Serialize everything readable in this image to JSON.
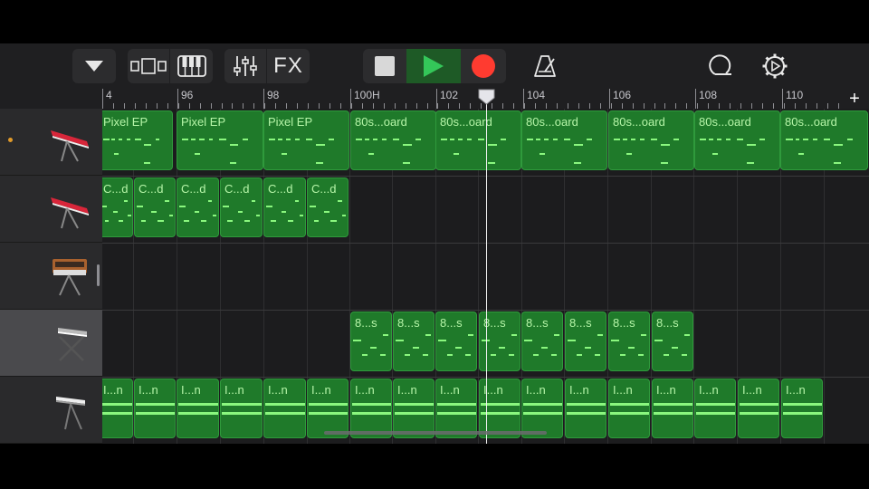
{
  "toolbar": {
    "buttons": [
      {
        "name": "tracks-menu",
        "icon": "chevron-down-icon"
      },
      {
        "name": "tracks-view",
        "icon": "tracks-view-icon"
      },
      {
        "name": "instrument-view",
        "icon": "piano-keys-icon"
      },
      {
        "name": "mixer",
        "icon": "mixer-sliders-icon"
      },
      {
        "name": "fx",
        "label": "FX"
      },
      {
        "name": "stop",
        "icon": "stop-icon"
      },
      {
        "name": "play",
        "icon": "play-icon"
      },
      {
        "name": "record",
        "icon": "record-icon"
      },
      {
        "name": "metronome",
        "icon": "metronome-icon"
      },
      {
        "name": "loop-browser",
        "icon": "loop-icon"
      },
      {
        "name": "settings",
        "icon": "gear-icon"
      }
    ],
    "fx_label": "FX",
    "colors": {
      "play": "#34c759",
      "record": "#ff3b30"
    }
  },
  "ruler": {
    "labels": [
      "4",
      "96",
      "98",
      "100H",
      "102",
      "104",
      "106",
      "108",
      "110"
    ],
    "add_label": "+"
  },
  "tracks": [
    {
      "instrument": "red-keyboard-icon",
      "selected": false,
      "record_enabled": true,
      "regions": [
        "Pixel EP",
        "Pixel EP",
        "Pixel EP",
        "80s...oard",
        "80s...oard",
        "80s...oard",
        "80s...oard",
        "80s...oard",
        "80s...oard"
      ]
    },
    {
      "instrument": "red-keyboard-icon",
      "selected": false,
      "record_enabled": false,
      "regions": [
        "C...d",
        "C...d",
        "C...d",
        "C...d",
        "C...d",
        "C...d"
      ]
    },
    {
      "instrument": "synth-icon",
      "selected": false,
      "record_enabled": false,
      "regions": []
    },
    {
      "instrument": "keyboard-stand-icon",
      "selected": true,
      "record_enabled": false,
      "regions": [
        "8...s",
        "8...s",
        "8...s",
        "8...s",
        "8...s",
        "8...s",
        "8...s",
        "8...s"
      ]
    },
    {
      "instrument": "digital-piano-icon",
      "selected": false,
      "record_enabled": false,
      "regions": [
        "I...n",
        "I...n",
        "I...n",
        "I...n",
        "I...n",
        "I...n",
        "I...n",
        "I...n",
        "I...n",
        "I...n",
        "I...n",
        "I...n",
        "I...n",
        "I...n",
        "I...n",
        "I...n",
        "I...n"
      ]
    }
  ],
  "colors": {
    "region_fill": "#1f7a2a",
    "region_text": "#b6f5a8",
    "note": "#8af77e",
    "record_indicator": "#e09a2a"
  }
}
